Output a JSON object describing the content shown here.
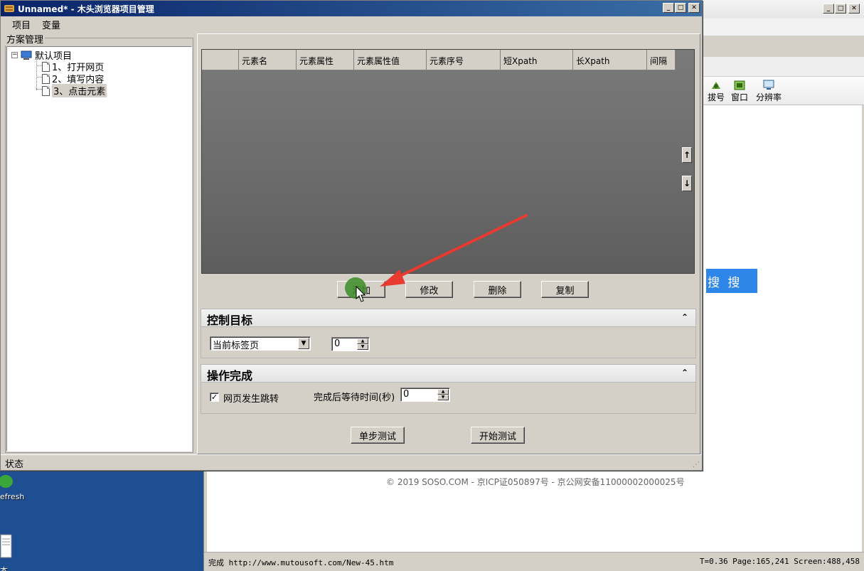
{
  "desktop": {
    "refresh_label": "efresh",
    "file_label": "本文档"
  },
  "bg_browser": {
    "toolbar": [
      {
        "label": "拔号",
        "icon": "dial-icon"
      },
      {
        "label": "窗口",
        "icon": "window-icon"
      },
      {
        "label": "分辨率",
        "icon": "monitor-icon"
      }
    ],
    "search_button": "搜 搜",
    "footer": "© 2019 SOSO.COM - 京ICP证050897号 - 京公网安备11000002000025号",
    "status_left": "完成 http://www.mutousoft.com/New-45.htm",
    "status_right": "T=0.36 Page:165,241 Screen:488,458"
  },
  "window": {
    "title": "Unnamed* - 木头浏览器项目管理",
    "menu": [
      "项目",
      "变量"
    ],
    "statusbar": "状态"
  },
  "tree": {
    "group_title": "方案管理",
    "root": "默认项目",
    "items": [
      "1、打开网页",
      "2、填写内容",
      "3、点击元素"
    ]
  },
  "grid": {
    "columns": [
      "",
      "元素名",
      "元素属性",
      "元素属性值",
      "元素序号",
      "短Xpath",
      "长Xpath",
      "间隔"
    ],
    "rows": []
  },
  "grid_buttons": {
    "add": "添加",
    "edit": "修改",
    "delete": "删除",
    "copy": "复制"
  },
  "control_target": {
    "title": "控制目标",
    "combo_value": "当前标签页",
    "index_value": "0"
  },
  "operation_done": {
    "title": "操作完成",
    "checkbox_label": "网页发生跳转",
    "checkbox_checked": true,
    "wait_label": "完成后等待时间(秒)",
    "wait_value": "0"
  },
  "test_buttons": {
    "step": "单步测试",
    "start": "开始测试"
  }
}
